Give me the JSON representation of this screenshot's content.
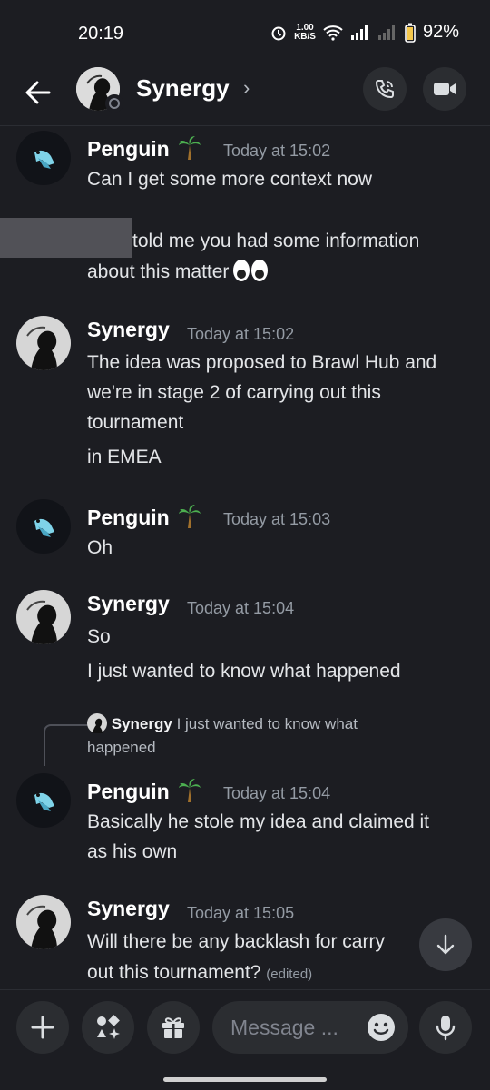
{
  "status": {
    "time": "20:19",
    "speed_top": "1.00",
    "speed_bottom": "KB/S",
    "battery": "92%"
  },
  "header": {
    "title": "Synergy",
    "chevron": "›"
  },
  "messages": [
    {
      "author": "Penguin",
      "time": "Today at 15:02",
      "lines": [
        "Can I get some more context now",
        "told me you had some information",
        "about this matter"
      ]
    },
    {
      "author": "Synergy",
      "time": "Today at 15:02",
      "lines": [
        "The idea was proposed to Brawl Hub and",
        "we're in stage 2 of carrying out this",
        "tournament",
        "in EMEA"
      ]
    },
    {
      "author": "Penguin",
      "time": "Today at 15:03",
      "lines": [
        "Oh"
      ]
    },
    {
      "author": "Synergy",
      "time": "Today at 15:04",
      "lines": [
        "So",
        "I just wanted to know what happened"
      ]
    },
    {
      "reply": {
        "author": "Synergy",
        "text": "I just wanted to know what",
        "text2": "happened"
      },
      "author": "Penguin",
      "time": "Today at 15:04",
      "lines": [
        "Basically he stole my idea and claimed it",
        "as his own"
      ]
    },
    {
      "author": "Synergy",
      "time": "Today at 15:05",
      "lines": [
        "Will there be any backlash for carry",
        "out this tournament?"
      ],
      "edited": "(edited)"
    }
  ],
  "composer": {
    "placeholder": "Message ..."
  }
}
